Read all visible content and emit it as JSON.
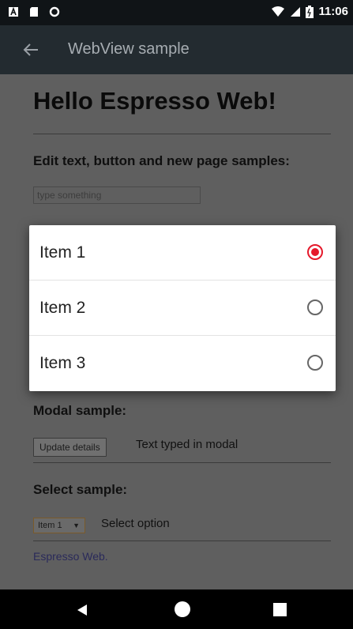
{
  "status_bar": {
    "time": "11:06",
    "icons": [
      "a-icon",
      "sd-card-icon",
      "circle-icon",
      "wifi-icon",
      "signal-icon",
      "battery-icon"
    ]
  },
  "app_bar": {
    "back_icon": "arrow-left-icon",
    "title": "WebView sample"
  },
  "page": {
    "heading": "Hello Espresso Web!",
    "edit_section_title": "Edit text, button and new page samples:",
    "text_input_placeholder": "type something",
    "modal_section_title": "Modal sample:",
    "update_button_label": "Update details",
    "modal_text": "Text typed in modal",
    "select_section_title": "Select sample:",
    "select_value": "Item 1",
    "select_caret": "▼",
    "select_label": "Select option",
    "link_text": "Espresso Web."
  },
  "dialog": {
    "options": [
      {
        "label": "Item 1",
        "selected": true
      },
      {
        "label": "Item 2",
        "selected": false
      },
      {
        "label": "Item 3",
        "selected": false
      }
    ]
  },
  "colors": {
    "accent": "#e5192b",
    "status_bar": "#101417",
    "app_bar": "#232b30",
    "scrim_content": "#5f5f5f"
  }
}
